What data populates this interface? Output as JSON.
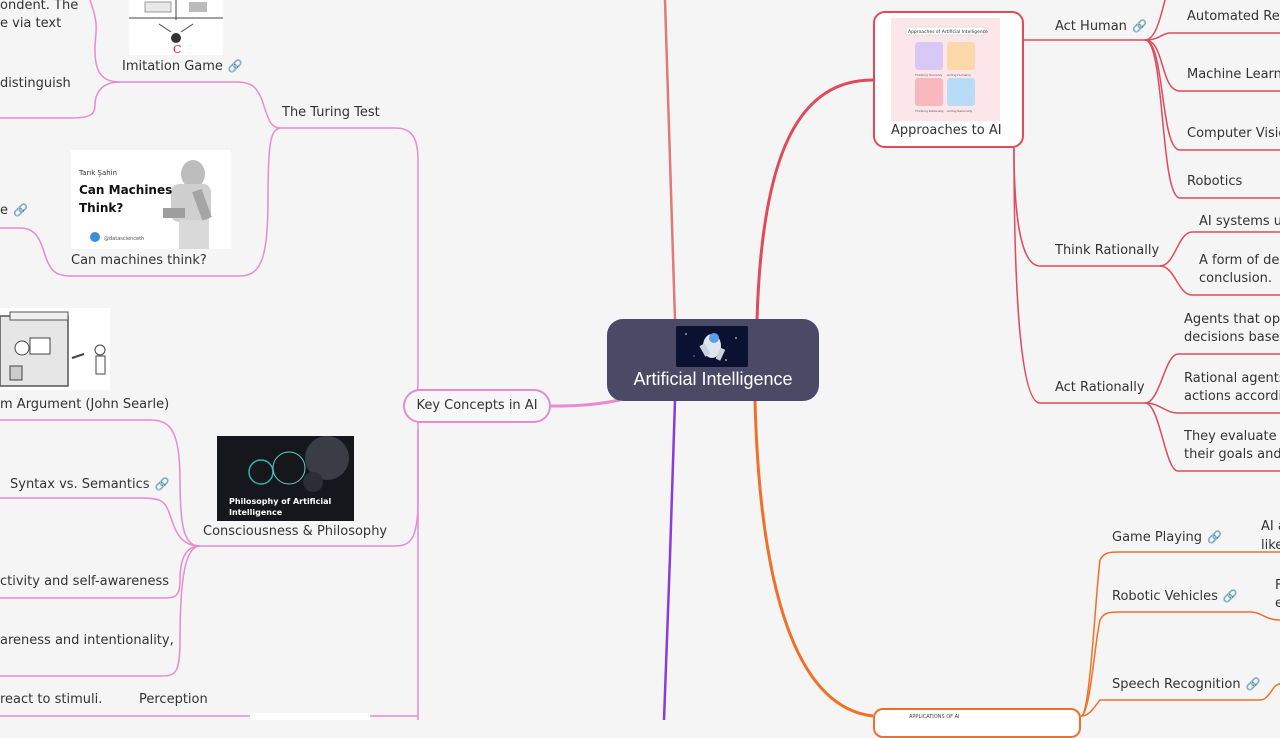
{
  "central": {
    "title": "Artificial Intelligence",
    "thumb_icon": "astronaut-image"
  },
  "left": {
    "key_concepts": "Key Concepts in AI",
    "turing_test": "The Turing Test",
    "imitation_game": "Imitation Game",
    "imitation_text1": "ondent. The",
    "imitation_text2": "e via text",
    "imitation_text3": "distinguish",
    "can_machines_think": "Can machines think?",
    "cmt_left_fragment": "e",
    "cmt_image_author": "Tarık Şahin",
    "cmt_image_title1": "Can Machines",
    "cmt_image_title2": "Think?",
    "cmt_image_handle": "@datascienceth",
    "chinese_room": "m Argument (John Searle)",
    "consciousness": "Consciousness & Philosophy",
    "philosophy_image_title1": "Philosophy of Artificial",
    "philosophy_image_title2": "Intelligence",
    "syntax": "Syntax vs. Semantics",
    "subjectivity": "ctivity and self-awareness",
    "awareness": "areness and intentionality,",
    "react": "react to stimuli.",
    "perception": "Perception"
  },
  "right": {
    "approaches": "Approaches to AI",
    "approaches_image_title": "Approaches of Artificial Intelligence",
    "approaches_image_cells": [
      "Thinking Humanly",
      "Acting Humanly",
      "Thinking Rationally",
      "Acting Rationally"
    ],
    "act_human": "Act Human",
    "automated": "Automated Rea",
    "machine_learning": "Machine Learni",
    "computer_vision": "Computer Visio",
    "robotics": "Robotics",
    "think_rationally": "Think Rationally",
    "tr_1": "AI systems use",
    "tr_2a": "A form of ded",
    "tr_2b": "conclusion.",
    "act_rationally": "Act Rationally",
    "ar_1a": "Agents that oper",
    "ar_1b": "decisions based",
    "ar_2a": "Rational agents",
    "ar_2b": "actions accordi",
    "ar_3a": "They evaluate p",
    "ar_3b": "their goals and a",
    "game_playing": "Game Playing",
    "gp_a": "AI a",
    "gp_b": "like",
    "robotic_vehicles": "Robotic Vehicles",
    "rv_a": "F",
    "rv_b": "e",
    "speech": "Speech Recognition",
    "orange_card_caption": "APPLICATIONS OF AI"
  },
  "colors": {
    "pink": "#e78bd2",
    "red": "#e04a5a",
    "orange": "#f07028",
    "purple": "#8a3be0",
    "salmon": "#e07a7a",
    "central_bg": "#4a4a66"
  }
}
